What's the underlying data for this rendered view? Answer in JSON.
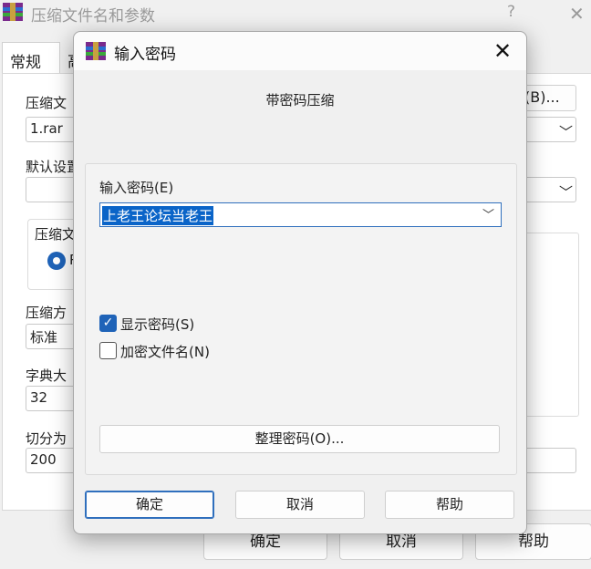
{
  "background_window": {
    "title": "压缩文件名和参数",
    "help_icon": "?",
    "close_icon": "✕",
    "tabs": [
      "常规",
      "高"
    ],
    "archive_name_label": "压缩文",
    "archive_name_value": "1.rar",
    "browse_label": "(B)...",
    "default_profile_label": "默认设置",
    "format_group_label": "压缩文",
    "format_radio_label": "R",
    "method_label": "压缩方",
    "method_value": "标准",
    "dictionary_label": "字典大",
    "dictionary_value": "32",
    "split_label": "切分为",
    "split_value": "200",
    "buttons": {
      "ok": "确定",
      "cancel": "取消",
      "help": "帮助"
    }
  },
  "dialog": {
    "title": "输入密码",
    "close_icon": "✕",
    "heading": "带密码压缩",
    "password_label": "输入密码(E)",
    "password_value": "上老王论坛当老王",
    "show_password": {
      "label": "显示密码(S)",
      "checked": true,
      "check_glyph": "✓"
    },
    "encrypt_names": {
      "label": "加密文件名(N)",
      "checked": false
    },
    "organize_button": "整理密码(O)...",
    "buttons": {
      "ok": "确定",
      "cancel": "取消",
      "help": "帮助"
    },
    "accent_color": "#1f63b8"
  }
}
